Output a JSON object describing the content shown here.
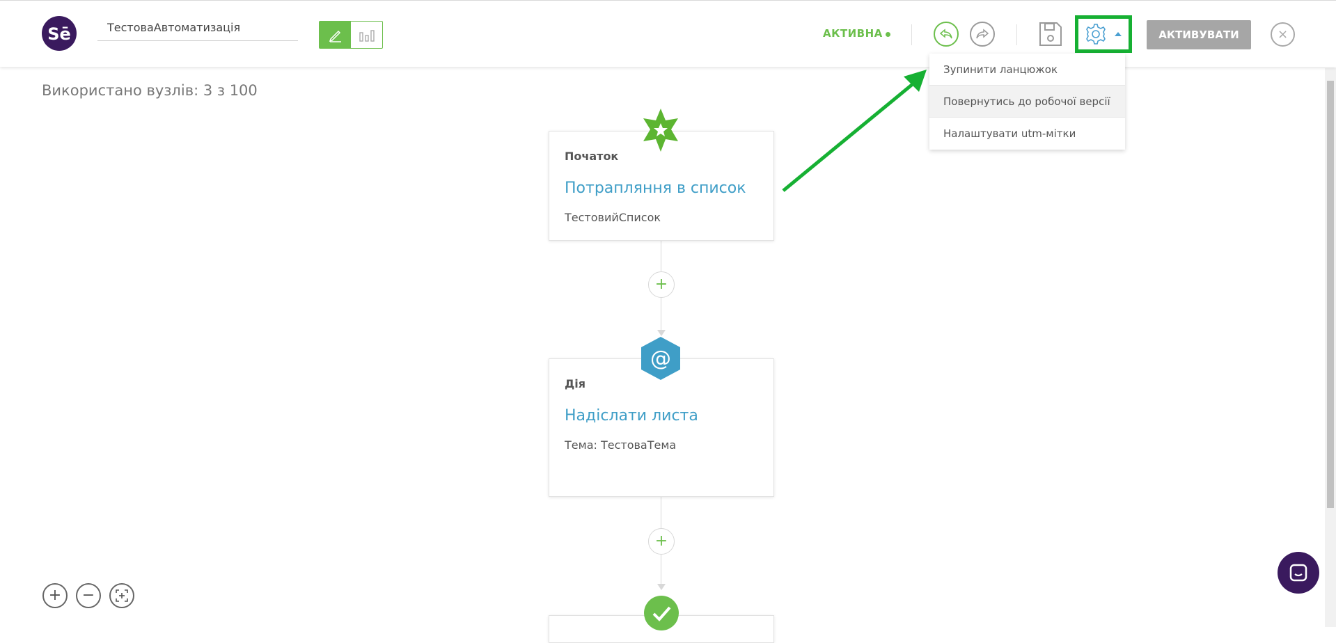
{
  "app": {
    "logo_text": "Sē",
    "automation_name": "ТестоваАвтоматизація",
    "status_label": "АКТИВНА",
    "activate_label": "АКТИВУВАТИ",
    "close_label": "×"
  },
  "settings_menu": {
    "items": [
      {
        "label": "Зупинити ланцюжок"
      },
      {
        "label": "Повернутись до робочої версії"
      },
      {
        "label": "Налаштувати utm-мітки"
      }
    ]
  },
  "canvas": {
    "node_usage": "Використано вузлів: 3 з 100",
    "nodes": [
      {
        "kind": "Початок",
        "title": "Потрапляння в список",
        "subtitle": "ТестовийСписок",
        "icon": "star-icon"
      },
      {
        "kind": "Дія",
        "title": "Надіслати листа",
        "subtitle": "Тема: ТестоваТема",
        "icon": "at-icon"
      },
      {
        "kind": "",
        "title": "",
        "subtitle": "",
        "icon": "check-icon"
      }
    ],
    "add_label": "+"
  },
  "zoom": {
    "in_label": "+",
    "out_label": "−"
  },
  "colors": {
    "accent_green": "#6cbf4c",
    "link_blue": "#3f9ec7",
    "brand_purple": "#3a1a5e",
    "highlight_green": "#16b033",
    "disabled_gray": "#a6a6a6"
  }
}
